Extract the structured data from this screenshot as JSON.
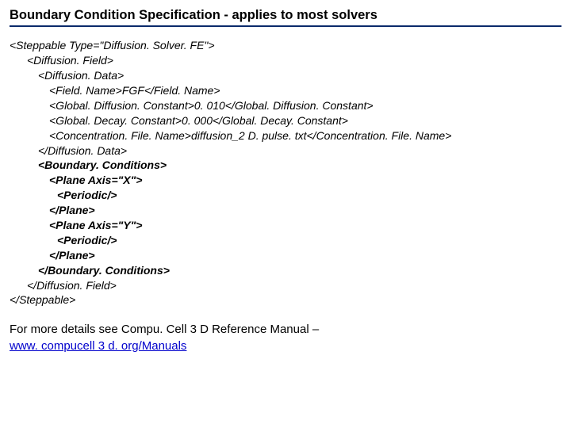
{
  "title": "Boundary Condition Specification -  applies to most solvers",
  "code": {
    "l1": "<Steppable Type=\"Diffusion. Solver. FE\">",
    "l2": "<Diffusion. Field>",
    "l3": "<Diffusion. Data>",
    "l4": "<Field. Name>FGF</Field. Name>",
    "l5": "<Global. Diffusion. Constant>0. 010</Global. Diffusion. Constant>",
    "l6": "<Global. Decay. Constant>0. 000</Global. Decay. Constant>",
    "l7": "<Concentration. File. Name>diffusion_2 D. pulse. txt</Concentration. File. Name>",
    "l8": "</Diffusion. Data>",
    "l9": "<Boundary. Conditions>",
    "l10": "<Plane Axis=\"X\">",
    "l11": "<Periodic/>",
    "l12": "</Plane>",
    "l13": "<Plane Axis=\"Y\">",
    "l14": "<Periodic/>",
    "l15": "</Plane>",
    "l16": "</Boundary. Conditions>",
    "l17": "</Diffusion. Field>",
    "l18": "</Steppable>"
  },
  "footer": {
    "text": "For more details see Compu. Cell 3 D Reference Manual –",
    "link": "www. compucell 3 d. org/Manuals"
  }
}
